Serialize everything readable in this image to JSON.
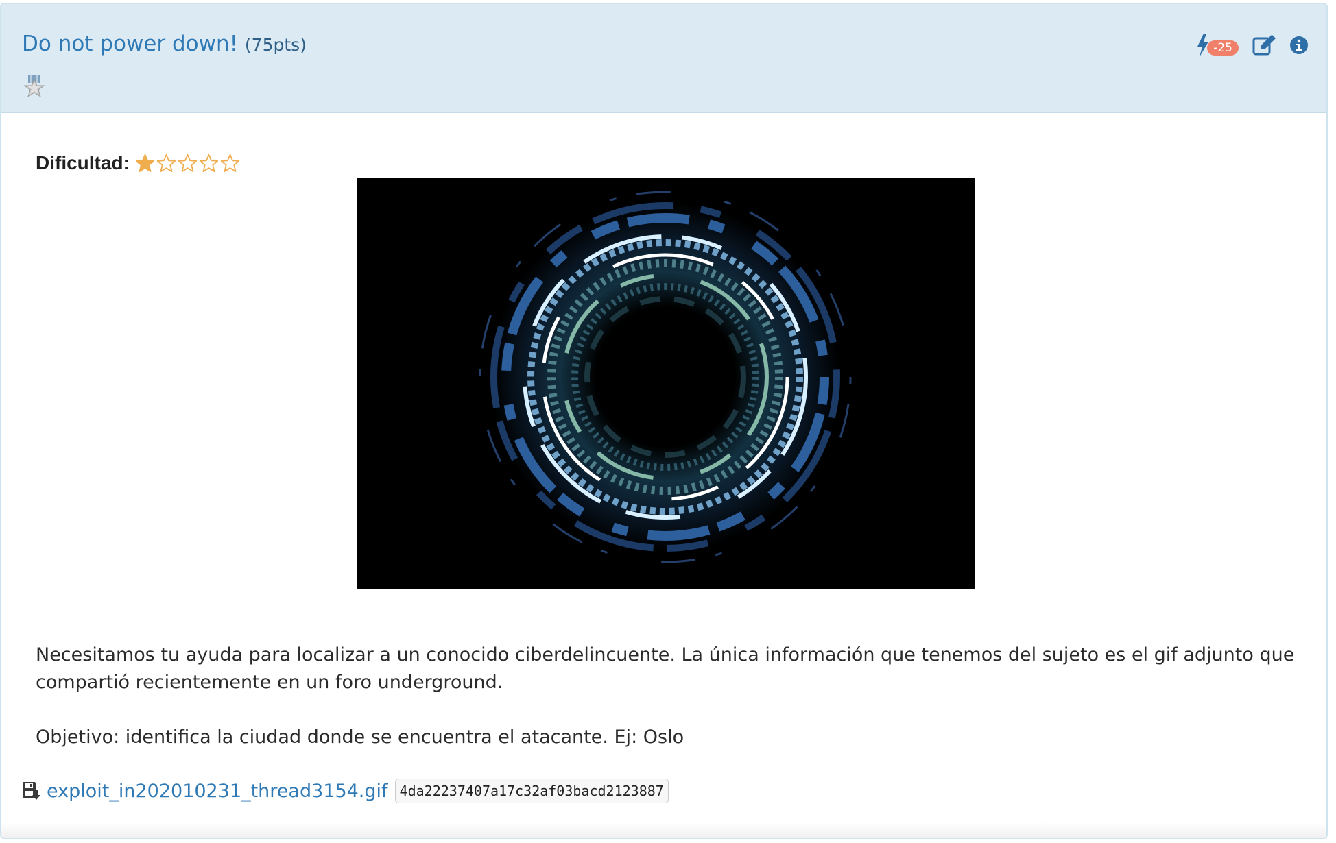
{
  "challenge": {
    "title": "Do not power down!",
    "points": "(75pts)",
    "bolt_count": "-25"
  },
  "difficulty": {
    "label": "Dificultad:",
    "rating": 1,
    "max": 5,
    "star_color": "#f0ad4e"
  },
  "image": {
    "alt": "Glowing circular tech rings on black background"
  },
  "description": {
    "paragraph": "Necesitamos tu ayuda para localizar a un conocido ciberdelincuente. La única información que tenemos del sujeto es el gif adjunto que compartió recientemente en un foro underground.",
    "objective": "Objetivo: identifica la ciudad donde se encuentra el atacante. Ej: Oslo"
  },
  "attachment": {
    "filename": "exploit_in202010231_thread3154.gif",
    "hash": "4da22237407a17c32af03bacd2123887"
  },
  "colors": {
    "header_bg": "#dceaf4",
    "link": "#2f79b5",
    "badge": "#f0806a"
  },
  "icons": {
    "bolt": "bolt-icon",
    "edit": "edit-icon",
    "info": "info-icon",
    "medal": "medal-icon",
    "download": "file-download-icon"
  }
}
